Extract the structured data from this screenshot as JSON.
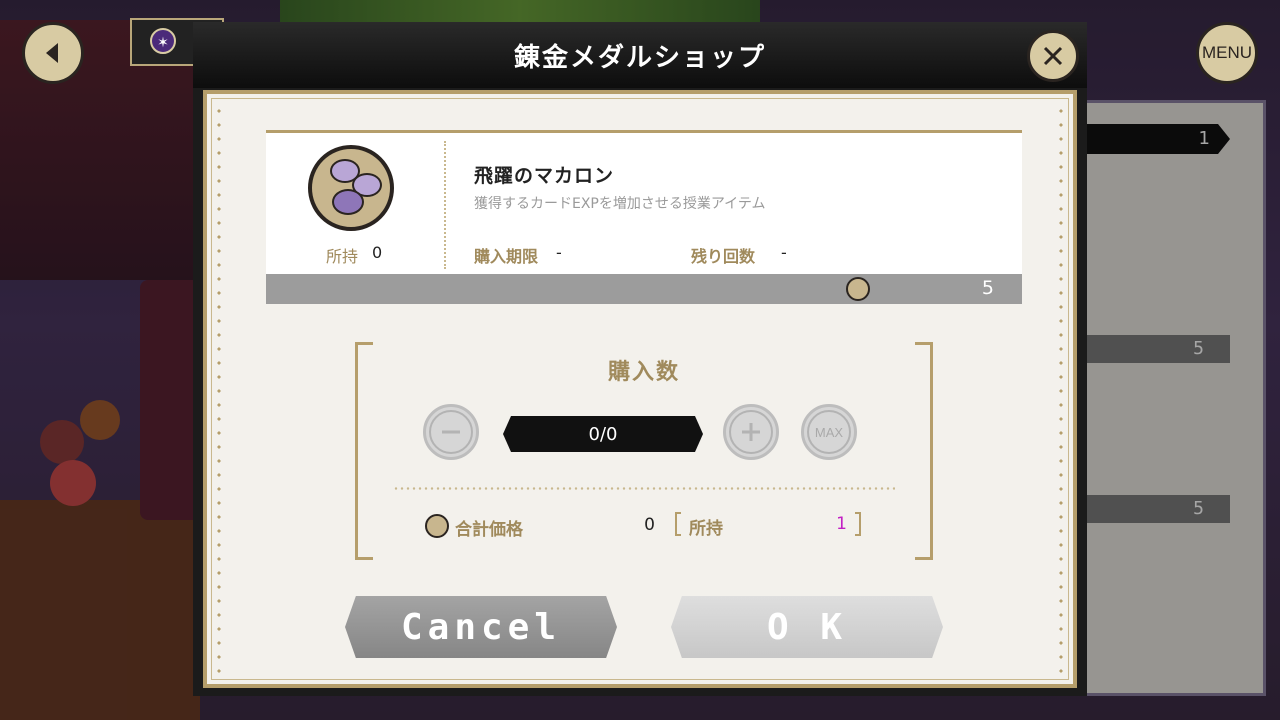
{
  "dialog": {
    "title": "錬金メダルショップ",
    "close_icon": "close-icon"
  },
  "item": {
    "name": "飛躍のマカロン",
    "description": "獲得するカードEXPを増加させる授業アイテム",
    "owned_label": "所持",
    "owned_value": "0",
    "limit_label": "購入期限",
    "limit_value": "-",
    "remaining_label": "残り回数",
    "remaining_value": "-",
    "price": "5",
    "icon": "macaron-icon",
    "currency_icon": "alchemy-medal-icon"
  },
  "quantity": {
    "title": "購入数",
    "display": "0/0",
    "minus_icon": "minus-icon",
    "plus_icon": "plus-icon",
    "max_label": "MAX",
    "total_label": "合計価格",
    "total_value": "0",
    "owned_label": "所持",
    "owned_value": "1"
  },
  "buttons": {
    "cancel": "Cancel",
    "ok": "O K"
  },
  "hud": {
    "back_icon": "back-arrow-icon",
    "menu_label": "MENU",
    "right_list_top": "1",
    "right_list_prices": [
      "5",
      "5"
    ]
  },
  "colors": {
    "accent_gold": "#b59e6b",
    "owned_highlight": "#c21fc4",
    "header_black": "#111111"
  }
}
